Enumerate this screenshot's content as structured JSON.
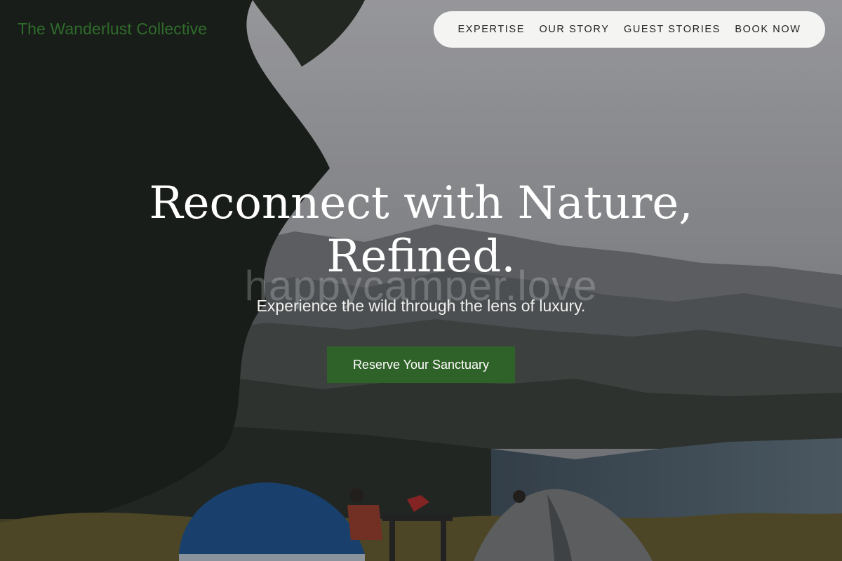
{
  "brand": {
    "name": "The Wanderlust Collective",
    "color": "#2e6b2a"
  },
  "nav": {
    "items": [
      {
        "label": "EXPERTISE"
      },
      {
        "label": "OUR STORY"
      },
      {
        "label": "GUEST STORIES"
      },
      {
        "label": "BOOK NOW"
      }
    ]
  },
  "hero": {
    "headline_line1": "Reconnect with Nature,",
    "headline_line2": "Refined.",
    "watermark": "happycamper.love",
    "subheadline": "Experience the wild through the lens of luxury.",
    "cta_label": "Reserve Your Sanctuary",
    "cta_color": "#2f6228"
  }
}
